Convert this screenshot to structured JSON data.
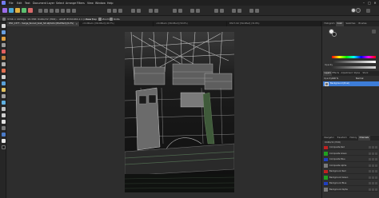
{
  "menu": {
    "items": [
      "File",
      "Edit",
      "Text",
      "Document",
      "Layer",
      "Select",
      "Arrange",
      "Filters",
      "View",
      "Window",
      "Help"
    ],
    "window_controls": [
      "–",
      "□",
      "✕"
    ]
  },
  "context": {
    "document_info": "3706 × 4934px, 18.3MP, RGBA/32 (HDR) – sRGB IEC61966-2.1 (Linear)",
    "buttons": [
      "Tone Map",
      "Zoom",
      "Units"
    ]
  },
  "tabs": [
    {
      "label": "DSC_1377 - merge_fenced_boat_hdr.afphoto [Modified] (6.2%)",
      "active": true
    },
    {
      "label": "<Untitled> [Modified] (49.7%)",
      "active": false
    },
    {
      "label": "<Untitled> [Modified] (50.0%)",
      "active": false
    },
    {
      "label": "DSC7-hdr [Modified] (31.8%)",
      "active": false
    }
  ],
  "panel_top": {
    "tabs": [
      "Histogram",
      "Color",
      "Swatches",
      "Brushes"
    ],
    "active": "Color",
    "opacity_label": "Opacity",
    "hue_gradient": [
      "#ff0000",
      "#ffff00",
      "#00ff00",
      "#00ffff",
      "#0000ff",
      "#ff00ff",
      "#ff0000"
    ]
  },
  "panel_layers": {
    "tabs": [
      "Layers",
      "Effects",
      "Adjustment",
      "Styles",
      "Stock"
    ],
    "active": "Layers",
    "opacity_label": "Opacity:",
    "opacity_value": "100 %",
    "blend_mode": "Normal",
    "layer_name": "Background",
    "layer_type": "(Pixel)"
  },
  "panel_channels": {
    "tabs": [
      "Navigator",
      "Transform",
      "History",
      "Channels"
    ],
    "active": "Channels",
    "header": "RGBA/32 (HDR)",
    "channels": [
      {
        "label": "Composite Red",
        "color": "#c02020"
      },
      {
        "label": "Composite Green",
        "color": "#20a020"
      },
      {
        "label": "Composite Blue",
        "color": "#2040c0"
      },
      {
        "label": "Composite Alpha",
        "color": "#7a7a7a"
      },
      {
        "label": "Background Red",
        "color": "#c02020"
      },
      {
        "label": "Background Green",
        "color": "#20a020"
      },
      {
        "label": "Background Blue",
        "color": "#2040c0"
      },
      {
        "label": "Background Alpha",
        "color": "#7a7a7a"
      }
    ]
  },
  "colors": {
    "accent": "#3d7dd8",
    "persona_photo": "#9b6be8",
    "persona_liquify": "#4aa9d6",
    "persona_develop": "#e0b040",
    "persona_tonemap": "#5cc070",
    "persona_export": "#d86a6a"
  }
}
